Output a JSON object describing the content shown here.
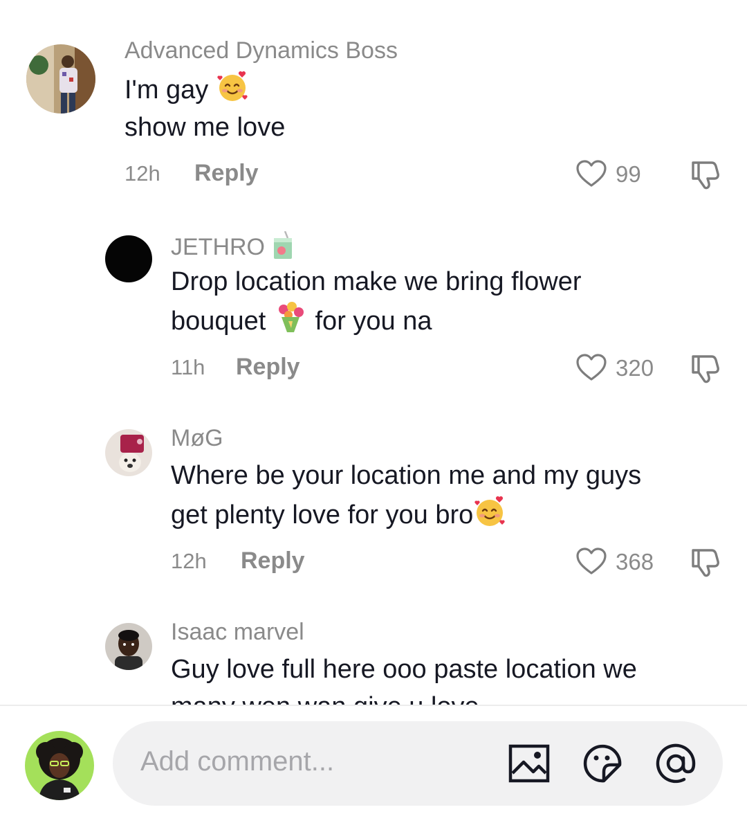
{
  "comments": [
    {
      "username": "Advanced Dynamics Boss",
      "lines": [
        "I'm gay",
        "show me love"
      ],
      "time": "12h",
      "reply_label": "Reply",
      "likes": "99"
    },
    {
      "username": "JETHRO",
      "lines": [
        "Drop location make we bring flower",
        "bouquet",
        "for you na"
      ],
      "time": "11h",
      "reply_label": "Reply",
      "likes": "320"
    },
    {
      "username": "MøG",
      "lines": [
        "Where be your location me and my guys",
        "get plenty love for you bro"
      ],
      "time": "12h",
      "reply_label": "Reply",
      "likes": "368"
    },
    {
      "username": "Isaac marvel",
      "lines": [
        "Guy love full here ooo paste location we",
        "many wen wan give u love"
      ]
    }
  ],
  "input": {
    "placeholder": "Add comment..."
  },
  "icons": {
    "like": "heart-outline-icon",
    "dislike": "thumbs-down-icon",
    "image": "image-icon",
    "emoji": "emoji-icon",
    "mention": "at-icon"
  },
  "colors": {
    "text": "#161823",
    "muted": "#8a8a8a",
    "input_bg": "#f1f1f2"
  }
}
